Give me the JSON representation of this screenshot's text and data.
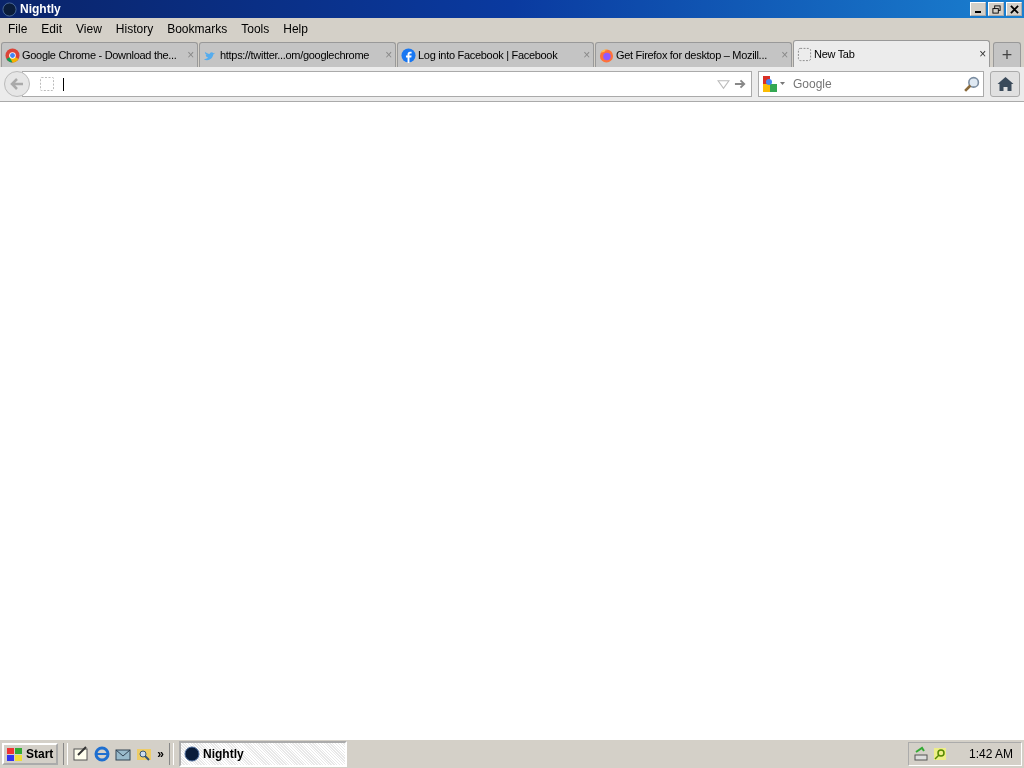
{
  "window": {
    "title": "Nightly"
  },
  "menu": [
    "File",
    "Edit",
    "View",
    "History",
    "Bookmarks",
    "Tools",
    "Help"
  ],
  "tabs": [
    {
      "label": "Google Chrome - Download the...",
      "kind": "chrome",
      "selected": false,
      "close": "×"
    },
    {
      "label": "https://twitter...om/googlechrome",
      "kind": "twitter",
      "selected": false,
      "close": "×"
    },
    {
      "label": "Log into Facebook | Facebook",
      "kind": "facebook",
      "selected": false,
      "close": "×"
    },
    {
      "label": "Get Firefox for desktop – Mozill...",
      "kind": "firefox",
      "selected": false,
      "close": "×"
    },
    {
      "label": "New Tab",
      "kind": "blank",
      "selected": true,
      "close": "×"
    }
  ],
  "new_tab": "+",
  "search": {
    "placeholder": "Google"
  },
  "taskbar": {
    "start": "Start",
    "chevron": "»",
    "tasks": [
      {
        "label": "Nightly",
        "selected": true
      }
    ],
    "clock": "1:42 AM"
  }
}
